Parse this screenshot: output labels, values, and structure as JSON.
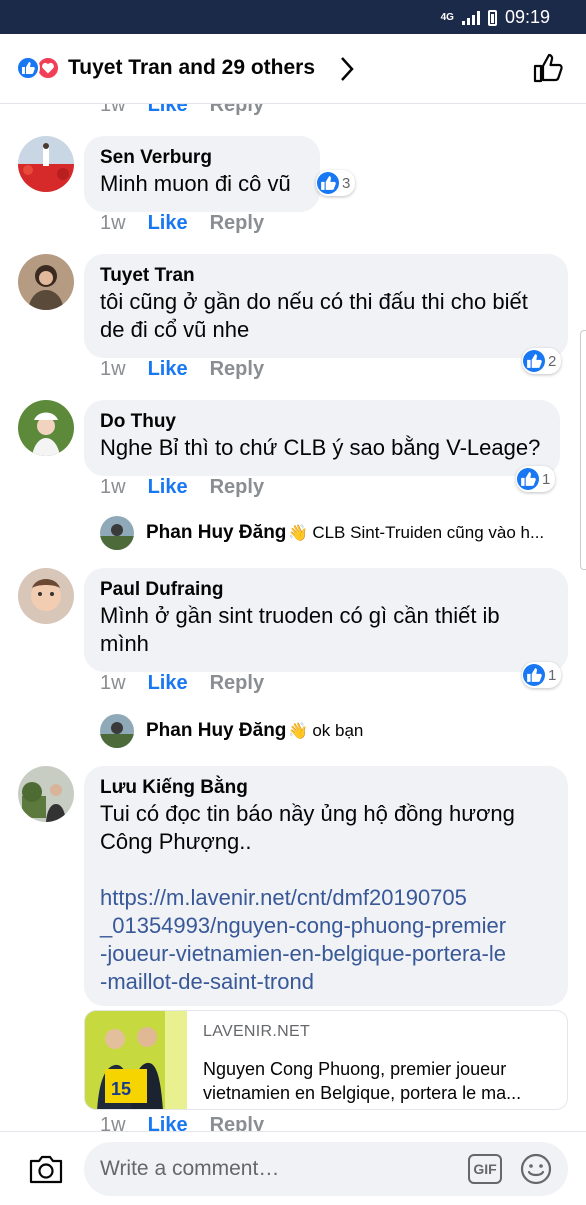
{
  "status_bar": {
    "network": "4G",
    "time": "09:19"
  },
  "header": {
    "title": "Tuyet Tran and 29 others"
  },
  "top_partial_meta": {
    "time": "1w",
    "like": "Like",
    "reply": "Reply"
  },
  "comments": [
    {
      "name": "Sen Verburg",
      "text": [
        "Minh muon đi cô vũ"
      ],
      "time": "1w",
      "like": "Like",
      "reply": "Reply",
      "reactions": "3"
    },
    {
      "name": "Tuyet Tran",
      "text": [
        "tôi cũng ở gần do nếu có thi đấu thi cho biết",
        "de đi cổ vũ nhe"
      ],
      "time": "1w",
      "like": "Like",
      "reply": "Reply",
      "reactions": "2"
    },
    {
      "name": "Do Thuy",
      "text": [
        "Nghe Bỉ thì to chứ CLB ý sao bằng V-Leage?"
      ],
      "time": "1w",
      "like": "Like",
      "reply": "Reply",
      "reactions": "1",
      "reply_preview": {
        "name": "Phan Huy Đăng",
        "text": "CLB Sint-Truiden cũng vào h..."
      }
    },
    {
      "name": "Paul Dufraing",
      "text": [
        "Mình ở gần sint truoden có gì cần thiết ib",
        "mình"
      ],
      "time": "1w",
      "like": "Like",
      "reply": "Reply",
      "reactions": "1",
      "reply_preview": {
        "name": "Phan Huy Đăng",
        "text": "ok bạn"
      }
    },
    {
      "name": "Lưu Kiếng Bằng",
      "text": [
        "Tui có đọc tin báo nầy ủng hộ đồng hương",
        "Công Phượng.."
      ],
      "link": [
        "https://m.lavenir.net/cnt/dmf20190705",
        "_01354993/nguyen-cong-phuong-premier",
        "-joueur-vietnamien-en-belgique-portera-le",
        "-maillot-de-saint-trond"
      ],
      "preview": {
        "domain": "LAVENIR.NET",
        "title": "Nguyen Cong Phuong, premier joueur vietnamien en Belgique, portera le ma..."
      },
      "time": "1w",
      "like": "Like",
      "reply": "Reply"
    }
  ],
  "composer": {
    "placeholder": "Write a comment…",
    "gif_label": "GIF"
  },
  "colors": {
    "accent": "#1877f2",
    "bubble": "#f0f2f5",
    "link": "#385898",
    "status_bar": "#1c2a4a"
  }
}
